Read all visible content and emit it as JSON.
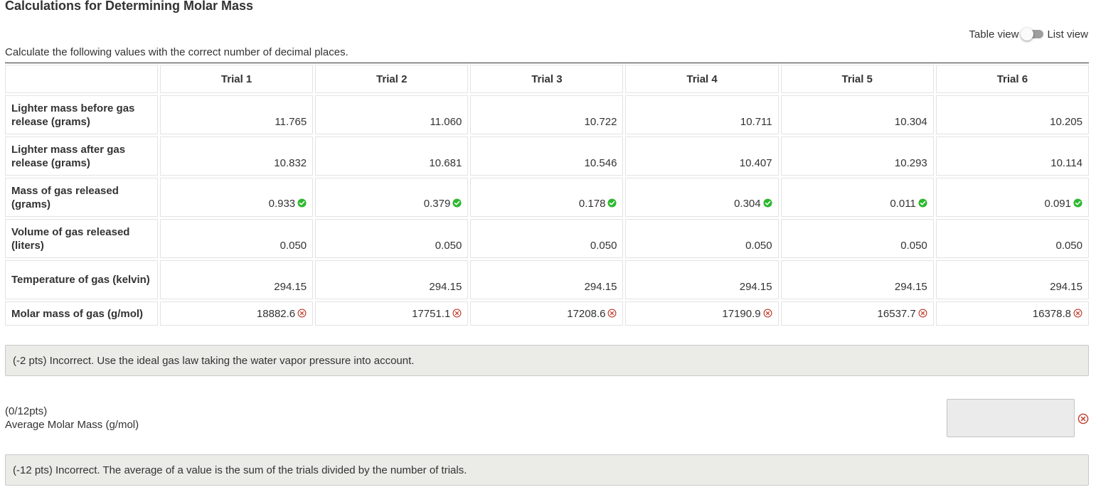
{
  "title": "Calculations for Determining Molar Mass",
  "view_toggle": {
    "left_label": "Table view",
    "right_label": "List view"
  },
  "instructions": "Calculate the following values with the correct number of decimal places.",
  "table": {
    "columns": [
      "Trial 1",
      "Trial 2",
      "Trial 3",
      "Trial 4",
      "Trial 5",
      "Trial 6"
    ],
    "rows": [
      {
        "label": "Lighter mass before gas release (grams)",
        "values": [
          "11.765",
          "11.060",
          "10.722",
          "10.711",
          "10.304",
          "10.205"
        ],
        "status": "none"
      },
      {
        "label": "Lighter mass after gas release (grams)",
        "values": [
          "10.832",
          "10.681",
          "10.546",
          "10.407",
          "10.293",
          "10.114"
        ],
        "status": "none"
      },
      {
        "label": "Mass of gas released (grams)",
        "values": [
          "0.933",
          "0.379",
          "0.178",
          "0.304",
          "0.011",
          "0.091"
        ],
        "status": "correct"
      },
      {
        "label": "Volume of gas released (liters)",
        "values": [
          "0.050",
          "0.050",
          "0.050",
          "0.050",
          "0.050",
          "0.050"
        ],
        "status": "none"
      },
      {
        "label": "Temperature of gas (kelvin)",
        "values": [
          "294.15",
          "294.15",
          "294.15",
          "294.15",
          "294.15",
          "294.15"
        ],
        "status": "none"
      },
      {
        "label": "Molar mass of gas (g/mol)",
        "values": [
          "18882.6",
          "17751.1",
          "17208.6",
          "17190.9",
          "16537.7",
          "16378.8"
        ],
        "status": "incorrect"
      }
    ]
  },
  "feedback_molar_mass": "(-2 pts) Incorrect. Use the ideal gas law taking the water vapor pressure into account.",
  "average": {
    "points": "(0/12pts)",
    "label": "Average Molar Mass (g/mol)",
    "value": "",
    "status": "incorrect"
  },
  "feedback_average": "(-12 pts) Incorrect. The average of a value is the sum of the trials divided by the number of trials.",
  "colors": {
    "text": "#333333",
    "correct_green": "#2eb82e",
    "incorrect_red": "#c0392b",
    "feedback_bg": "#ebebe7",
    "cell_border": "#e3e3e3"
  },
  "icons": {
    "correct": "check-circle-icon",
    "incorrect": "x-circle-icon"
  }
}
